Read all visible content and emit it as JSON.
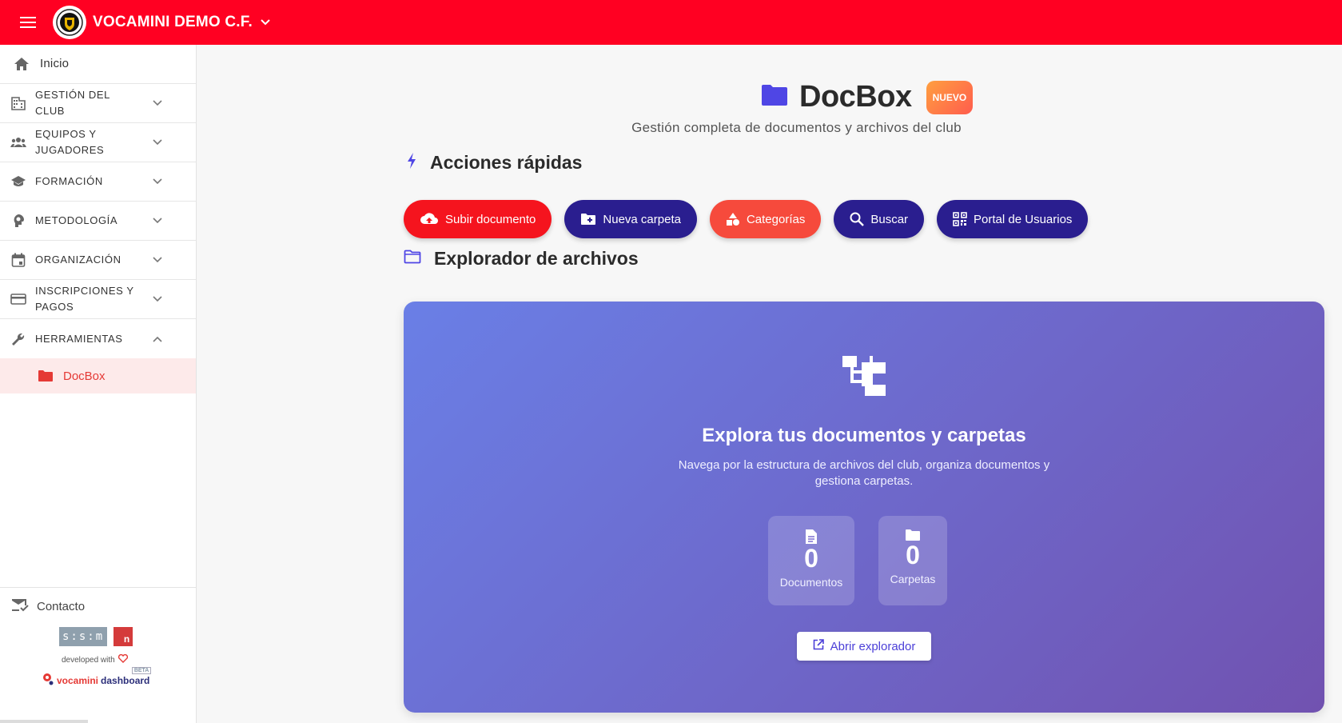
{
  "topbar": {
    "club_name": "VOCAMINI DEMO C.F."
  },
  "sidebar": {
    "home": "Inicio",
    "items": [
      {
        "label": "GESTIÓN DEL CLUB",
        "icon": "building-icon"
      },
      {
        "label": "EQUIPOS Y JUGADORES",
        "icon": "group-icon"
      },
      {
        "label": "FORMACIÓN",
        "icon": "graduation-cap-icon"
      },
      {
        "label": "METODOLOGÍA",
        "icon": "head-brain-icon"
      },
      {
        "label": "ORGANIZACIÓN",
        "icon": "calendar-icon"
      },
      {
        "label": "INSCRIPCIONES Y PAGOS",
        "icon": "credit-card-icon"
      },
      {
        "label": "HERRAMIENTAS",
        "icon": "wrench-icon"
      }
    ],
    "sub_item": "DocBox",
    "contact": "Contacto",
    "developed_with": "developed with",
    "brand_sism": "s:s:m",
    "brand_n": "n",
    "vd_logo_a": "vocamini",
    "vd_logo_b": "dashboard",
    "vd_beta": "BETA"
  },
  "header": {
    "title": "DocBox",
    "badge": "NUEVO",
    "subtitle": "Gestión completa de documentos y archivos del club"
  },
  "quick_actions": {
    "title": "Acciones rápidas",
    "buttons": [
      {
        "label": "Subir documento",
        "color": "#f5141e"
      },
      {
        "label": "Nueva carpeta",
        "color": "#2a1e8f"
      },
      {
        "label": "Categorías",
        "color": "#f64a3c"
      },
      {
        "label": "Buscar",
        "color": "#2a1e8f"
      },
      {
        "label": "Portal de Usuarios",
        "color": "#2a1e8f"
      }
    ]
  },
  "explorer": {
    "section_title": "Explorador de archivos",
    "title": "Explora tus documentos y carpetas",
    "description": "Navega por la estructura de archivos del club, organiza documentos y gestiona carpetas.",
    "stats": [
      {
        "value": "0",
        "label": "Documentos"
      },
      {
        "value": "0",
        "label": "Carpetas"
      }
    ],
    "open_button": "Abrir explorador"
  },
  "colors": {
    "brand_red": "#ff0022",
    "accent_indigo": "#4b3fd8",
    "gradient_start": "#6a7fe6",
    "gradient_end": "#7152b0"
  }
}
